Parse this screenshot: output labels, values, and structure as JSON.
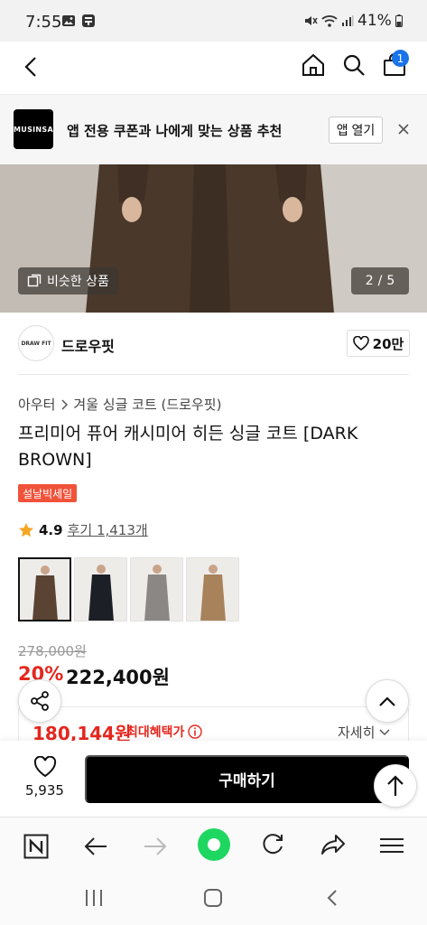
{
  "status_bar": {
    "time": "7:55",
    "battery": "41%"
  },
  "header": {
    "cart_count": "1"
  },
  "banner": {
    "logo_text": "MUSINSA",
    "message": "앱 전용 쿠폰과 나에게 맞는 상품 추천",
    "open_label": "앱 열기"
  },
  "gallery": {
    "similar_label": "비슷한 상품",
    "current": "2",
    "separator": "/",
    "total": "5"
  },
  "brand": {
    "logo_text": "DRAW FIT",
    "name": "드로우핏",
    "likes": "20만"
  },
  "breadcrumb": {
    "category": "아우터",
    "subcategory": "겨울 싱글 코트 (드로우핏)"
  },
  "product": {
    "title": "프리미어 퓨어 캐시미어 히든 싱글 코트 [DARK BROWN]",
    "badge": "설날빅세일",
    "rating": "4.9",
    "review_label": "후기 1,413개",
    "colors": [
      "#5a4332",
      "#1c1f26",
      "#8a8784",
      "#a8825a"
    ]
  },
  "pricing": {
    "original": "278,000원",
    "discount": "20%",
    "sale": "222,400원",
    "max_benefit_price": "180,144원",
    "max_benefit_label": "최대혜택가",
    "detail_label": "자세히"
  },
  "purchase_bar": {
    "wish_count": "5,935",
    "buy_label": "구매하기"
  },
  "colors": {
    "accent_red": "#e5271f",
    "badge": "#f0523a",
    "browser_green": "#1ed760"
  }
}
